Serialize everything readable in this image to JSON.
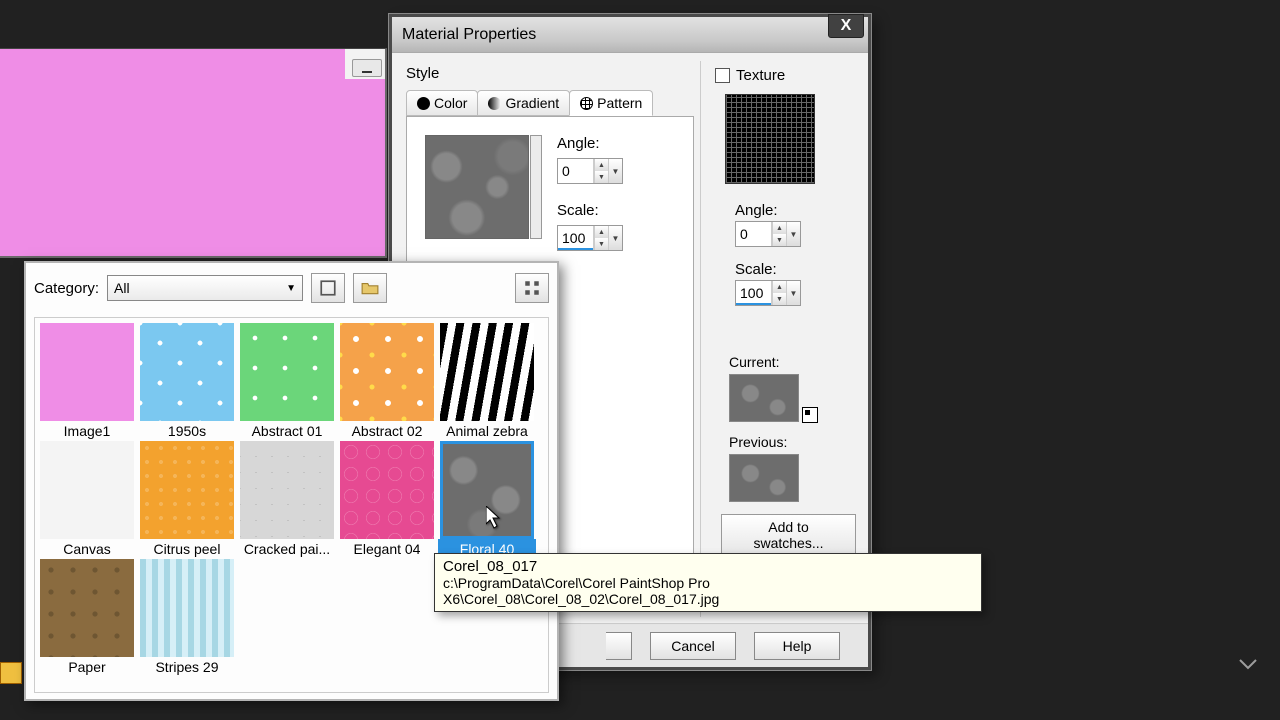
{
  "dialog": {
    "title": "Material Properties",
    "style_label": "Style",
    "tabs": {
      "color": "Color",
      "gradient": "Gradient",
      "pattern": "Pattern"
    },
    "angle_label": "Angle:",
    "scale_label": "Scale:",
    "angle_value": "0",
    "scale_value": "100",
    "texture_label": "Texture",
    "tex_angle_label": "Angle:",
    "tex_scale_label": "Scale:",
    "tex_angle_value": "0",
    "tex_scale_value": "100",
    "current_label": "Current:",
    "previous_label": "Previous:",
    "add_swatches": "Add to swatches...",
    "cancel": "Cancel",
    "help": "Help"
  },
  "picker": {
    "category_label": "Category:",
    "category_value": "All",
    "thumbs": [
      {
        "label": "Image1"
      },
      {
        "label": "1950s"
      },
      {
        "label": "Abstract 01"
      },
      {
        "label": "Abstract 02"
      },
      {
        "label": "Animal zebra"
      },
      {
        "label": "Canvas"
      },
      {
        "label": "Citrus peel"
      },
      {
        "label": "Cracked pai..."
      },
      {
        "label": "Elegant 04"
      },
      {
        "label": "Floral 40"
      },
      {
        "label": "Paper"
      },
      {
        "label": "Stripes 29"
      }
    ]
  },
  "tooltip": {
    "line1": "Corel_08_017",
    "line2": "c:\\ProgramData\\Corel\\Corel PaintShop Pro X6\\Corel_08\\Corel_08_02\\Corel_08_017.jpg"
  }
}
